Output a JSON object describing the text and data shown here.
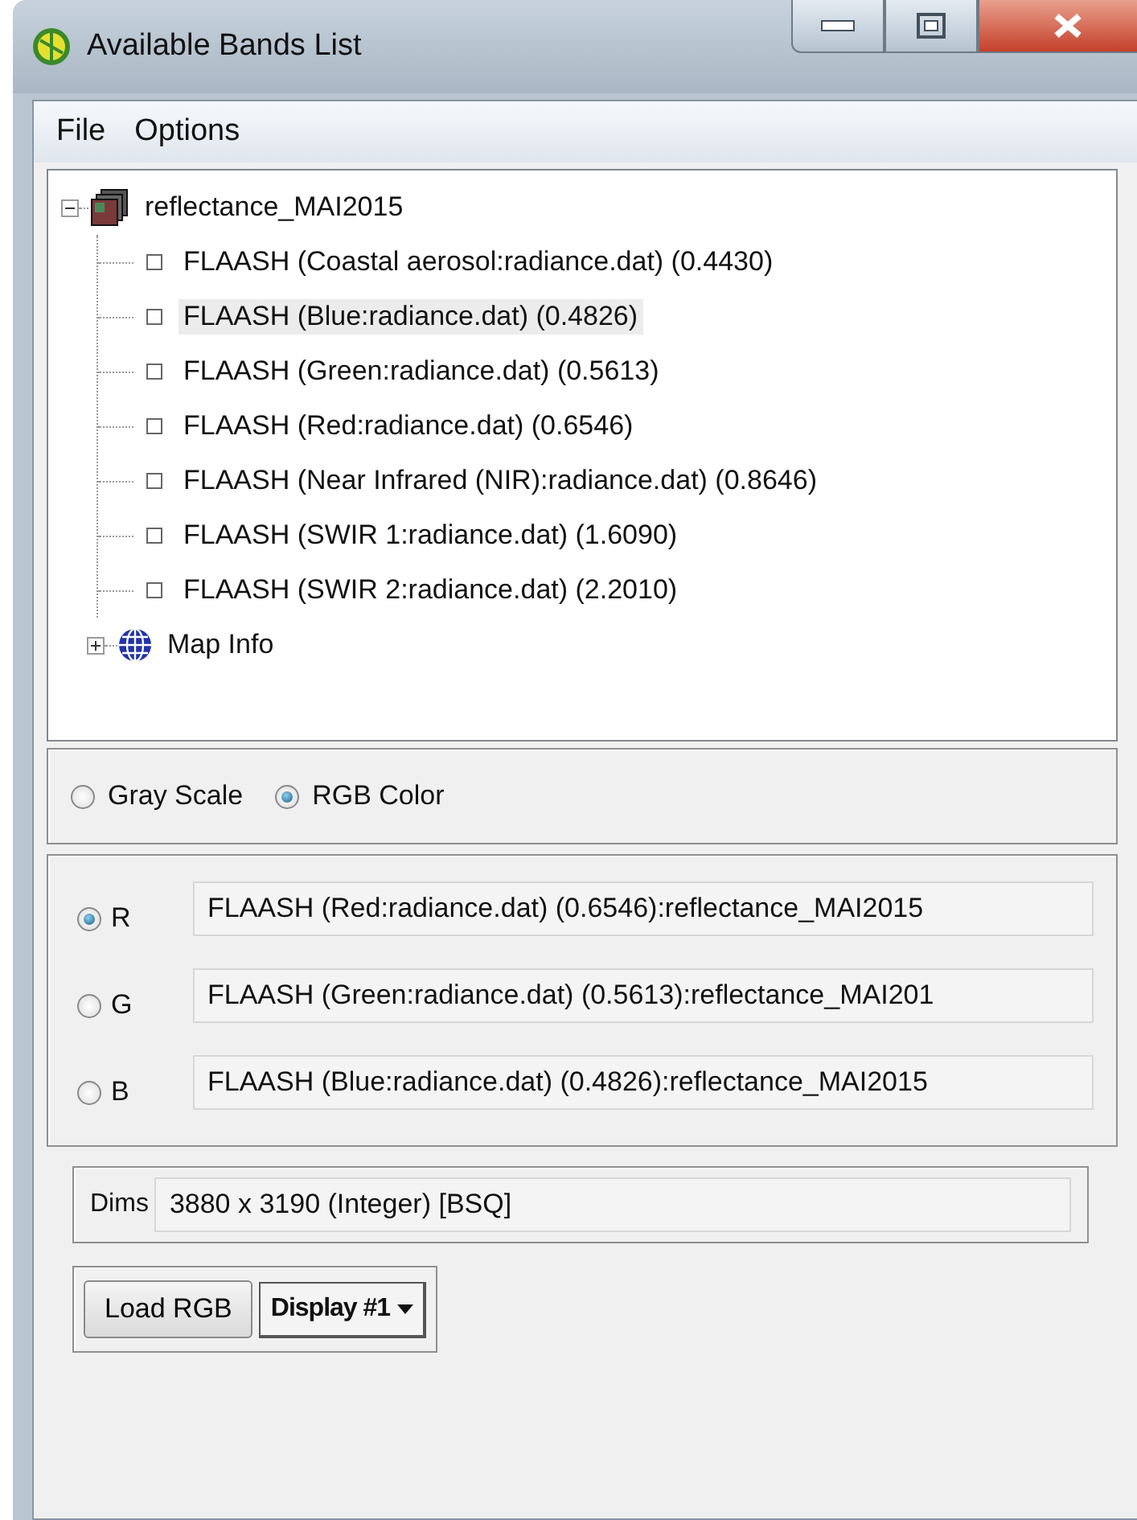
{
  "window": {
    "title": "Available Bands List"
  },
  "menu": [
    {
      "label": "File"
    },
    {
      "label": "Options"
    }
  ],
  "tree": {
    "label": "reflectance_MAI2015",
    "expanded": true,
    "children": [
      {
        "label": "FLAASH (Coastal aerosol:radiance.dat) (0.4430)",
        "selected": false
      },
      {
        "label": "FLAASH (Blue:radiance.dat) (0.4826)",
        "selected": true
      },
      {
        "label": "FLAASH (Green:radiance.dat) (0.5613)",
        "selected": false
      },
      {
        "label": "FLAASH (Red:radiance.dat) (0.6546)",
        "selected": false
      },
      {
        "label": "FLAASH (Near Infrared (NIR):radiance.dat) (0.8646)",
        "selected": false
      },
      {
        "label": "FLAASH (SWIR 1:radiance.dat) (1.6090)",
        "selected": false
      },
      {
        "label": "FLAASH (SWIR 2:radiance.dat) (2.2010)",
        "selected": false
      }
    ],
    "extra": {
      "label": "Map Info",
      "expanded": false
    }
  },
  "mode": [
    {
      "label": "Gray Scale",
      "selected": false
    },
    {
      "label": "RGB Color",
      "selected": true
    }
  ],
  "channels": [
    {
      "label": "R",
      "selected": true,
      "value": "FLAASH (Red:radiance.dat) (0.6546):reflectance_MAI2015"
    },
    {
      "label": "G",
      "selected": false,
      "value": "FLAASH (Green:radiance.dat) (0.5613):reflectance_MAI201"
    },
    {
      "label": "B",
      "selected": false,
      "value": "FLAASH (Blue:radiance.dat) (0.4826):reflectance_MAI2015"
    }
  ],
  "dims": {
    "label": "Dims",
    "value": "3880 x 3190 (Integer) [BSQ]"
  },
  "buttons": {
    "load": "Load RGB",
    "display": "Display #1"
  }
}
